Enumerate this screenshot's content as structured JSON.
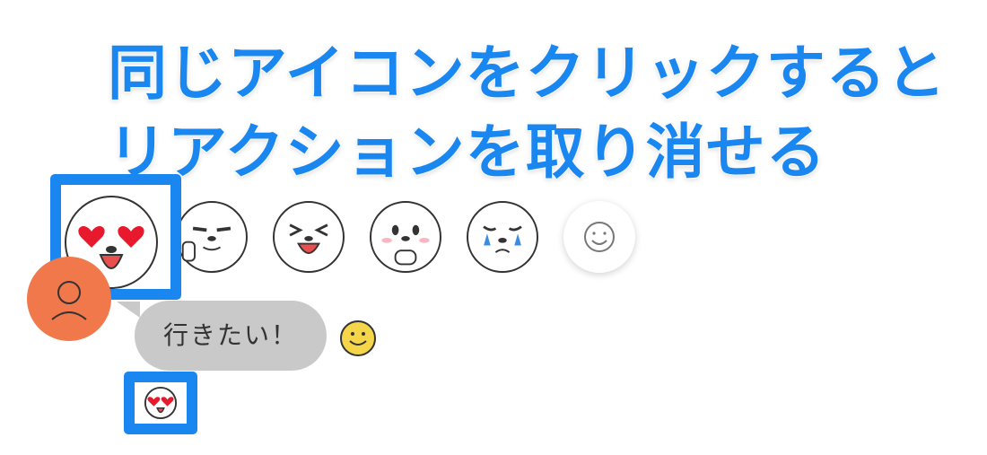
{
  "caption": {
    "line1": "同じアイコンをクリックすると",
    "line2": "リアクションを取り消せる"
  },
  "reactions": [
    {
      "name": "heart-eyes",
      "selected": true
    },
    {
      "name": "thumbs-up",
      "selected": false
    },
    {
      "name": "laughing",
      "selected": false
    },
    {
      "name": "pleading",
      "selected": false
    },
    {
      "name": "crying",
      "selected": false
    },
    {
      "name": "add-reaction",
      "selected": false
    }
  ],
  "message": {
    "text": "行きたい！"
  },
  "message_reaction": "heart-eyes",
  "colors": {
    "accent": "#1a87f0",
    "avatar": "#f0784b",
    "bubble": "#c9c9c9"
  }
}
